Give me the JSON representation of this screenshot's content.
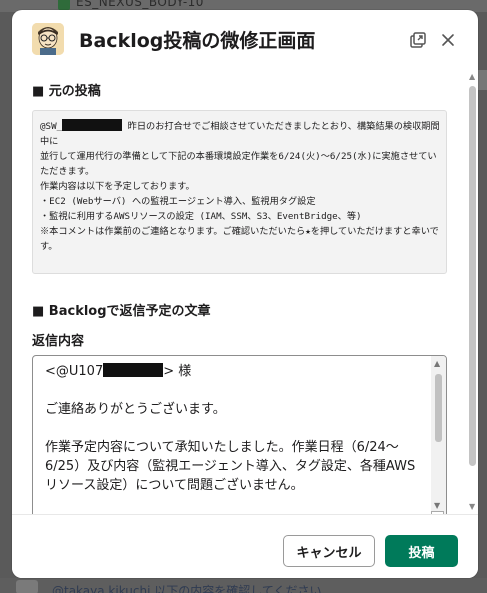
{
  "background": {
    "top_channel_text": "ES_NEXUS_BODY-10",
    "bottom_text": "@takaya kikuchi 以下の内容を確認してください"
  },
  "modal": {
    "title": "Backlog投稿の微修正画面",
    "app_icon": "avatar-illustration-icon",
    "original_post": {
      "heading": "■ 元の投稿",
      "mention_prefix": "@SW_",
      "line1_rest": " 昨日のお打合せでご相談させていただきましたとおり、構築結果の検収期間中に",
      "line2": "並行して運用代行の準備として下記の本番環境設定作業を6/24(火)～6/25(水)に実施させていただきます。",
      "line3": "作業内容は以下を予定しております。",
      "line4": "・EC2 (Webサーバ) への監視エージェント導入、監視用タグ設定",
      "line5": "・監視に利用するAWSリソースの設定 (IAM、SSM、S3、EventBridge、等)",
      "line6": "※本コメントは作業前のご連絡となります。ご確認いただいたら★を押していただけますと幸いです。"
    },
    "reply_section": {
      "heading": "■ Backlogで返信予定の文章",
      "field_label": "返信内容",
      "mention_prefix": "<@U107",
      "mention_suffix": "> 様",
      "para1": "ご連絡ありがとうございます。",
      "para2": "作業予定内容について承知いたしました。作業日程（6/24～6/25）及び内容（監視エージェント導入、タグ設定、各種AWSリソース設定）について問題ございません。"
    },
    "buttons": {
      "cancel": "キャンセル",
      "submit": "投稿"
    }
  },
  "colors": {
    "accent": "#007a5a",
    "overlay": "#5a5a5a"
  }
}
